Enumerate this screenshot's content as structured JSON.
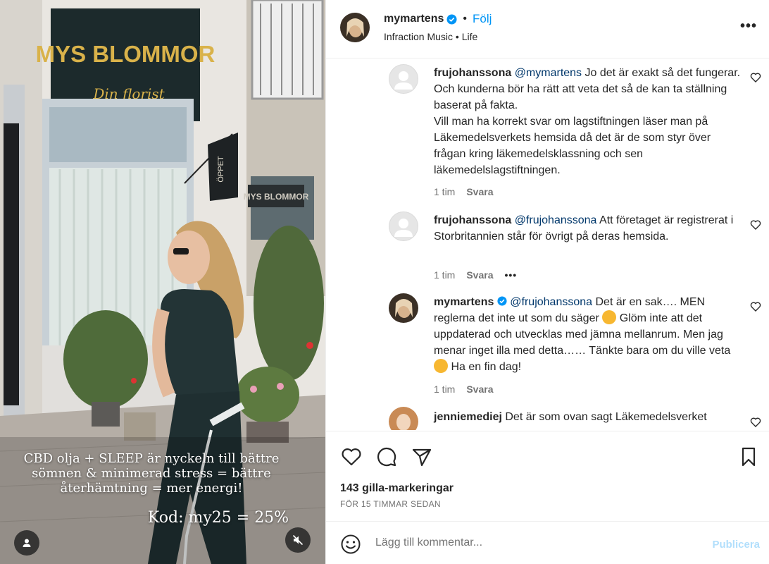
{
  "media": {
    "sign_title": "MYS BLOMMOR",
    "sign_subtitle": "Din florist",
    "flag_text": "ÖPPET",
    "window_sign": "MYS BLOMMOR",
    "caption_1": "CBD olja + SLEEP är nyckeln till bättre sömnen & minimerad stress = bättre återhämtning = mer energi!",
    "caption_2": "Kod: my25 = 25%"
  },
  "header": {
    "username": "mymartens",
    "follow_label": "Följ",
    "subtitle": "Infraction Music • Life",
    "more_label": "•••"
  },
  "comments": [
    {
      "username": "frujohanssona",
      "mention": "@mymartens",
      "text": " Jo det är exakt så det fungerar. Och kunderna bör ha rätt att veta det så de kan ta ställning baserat på fakta.",
      "text2": "Vill man ha korrekt svar om lagstiftningen läser man på Läkemedelsverkets hemsida då det är de som styr över frågan kring läkemedelsklassning och sen läkemedelslagstiftningen.",
      "time": "1 tim",
      "reply": "Svara"
    },
    {
      "username": "frujohanssona",
      "mention": "@frujohanssona",
      "text": " Att företaget är registrerat i Storbritannien står för övrigt på deras hemsida.",
      "time": "1 tim",
      "reply": "Svara",
      "more": "•••"
    },
    {
      "username": "mymartens",
      "mention": "@frujohanssona",
      "text_a": " Det är en sak…. MEN reglerna det inte ut som du säger ",
      "text_b": " Glöm inte att det uppdaterad och utvecklas med jämna mellanrum. Men jag menar inget illa med detta…… Tänkte bara om du ville veta ",
      "text_c": " Ha en fin dag!",
      "emoji": "smiling-face-with-hearts",
      "time": "1 tim",
      "reply": "Svara"
    },
    {
      "username": "jenniemediej",
      "text": " Det är som ovan sagt Läkemedelsverket"
    }
  ],
  "post": {
    "likes": "143 gilla-markeringar",
    "timestamp": "FÖR 15 TIMMAR SEDAN"
  },
  "composer": {
    "placeholder": "Lägg till kommentar...",
    "publish_label": "Publicera"
  },
  "colors": {
    "accent": "#0095f6",
    "mention": "#00376b",
    "muted": "#737373",
    "publish_disabled": "#b2dffc"
  }
}
